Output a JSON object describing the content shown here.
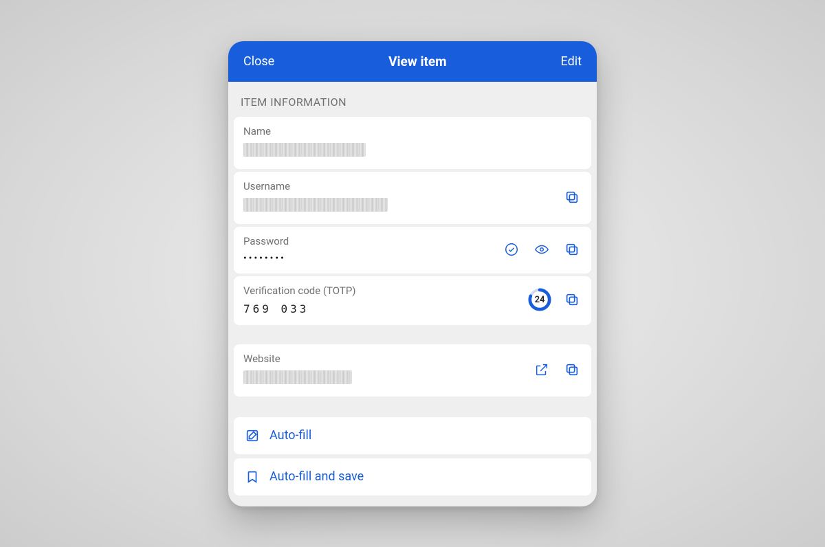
{
  "header": {
    "close": "Close",
    "title": "View item",
    "edit": "Edit"
  },
  "section_title": "ITEM INFORMATION",
  "fields": {
    "name": {
      "label": "Name",
      "value_redacted": true,
      "redact_width": 178
    },
    "username": {
      "label": "Username",
      "value_redacted": true,
      "redact_width": 210
    },
    "password": {
      "label": "Password",
      "masked": "••••••••"
    },
    "totp": {
      "label": "Verification code (TOTP)",
      "code": "769 033",
      "seconds": "24"
    },
    "website": {
      "label": "Website",
      "value_redacted": true,
      "redact_width": 158
    }
  },
  "actions": {
    "autofill": "Auto-fill",
    "autofill_save": "Auto-fill and save"
  },
  "colors": {
    "accent": "#175ddc"
  }
}
